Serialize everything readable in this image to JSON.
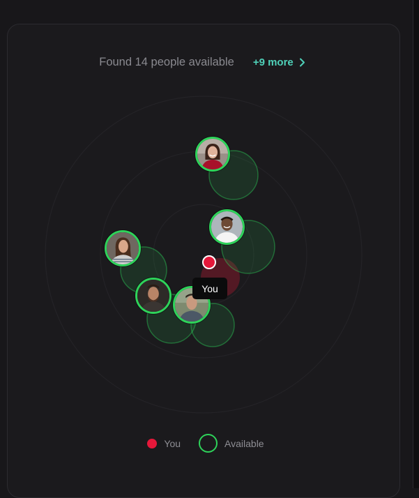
{
  "header": {
    "found_text": "Found 14 people available",
    "more_label": "+9 more",
    "more_icon": "chevron-right-icon"
  },
  "you_marker": {
    "tooltip": "You",
    "color": "#e5183a"
  },
  "people": [
    {
      "name": "person-1",
      "kind": "woman-red-top"
    },
    {
      "name": "person-2",
      "kind": "man-white-shirt"
    },
    {
      "name": "person-3",
      "kind": "woman-striped"
    },
    {
      "name": "person-4",
      "kind": "man-beard"
    },
    {
      "name": "person-5",
      "kind": "man-outdoor"
    }
  ],
  "legend": {
    "you_label": "You",
    "available_label": "Available"
  },
  "colors": {
    "available": "#2ed35a",
    "accent": "#4fd1b9",
    "you": "#e5183a"
  }
}
